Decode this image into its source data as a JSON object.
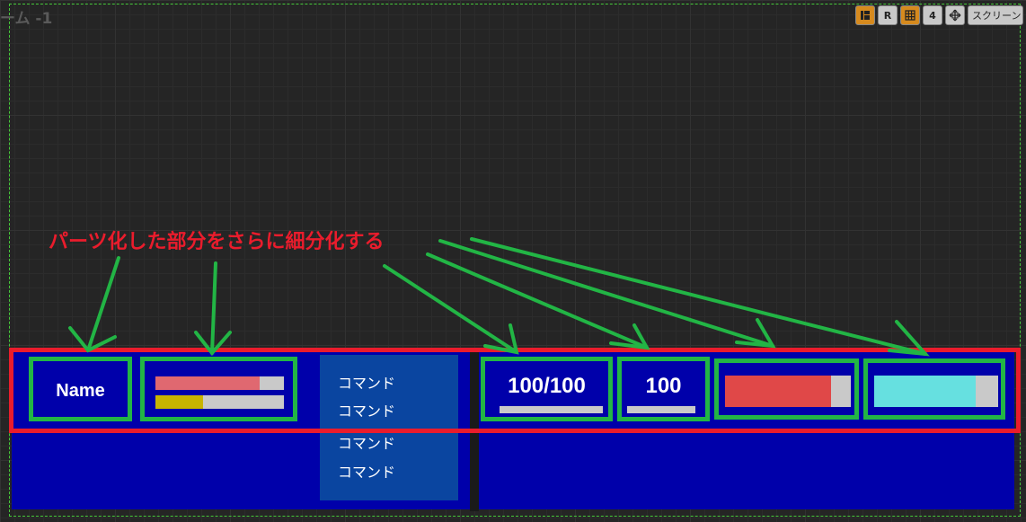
{
  "viewport": {
    "title": "ーム -1"
  },
  "toolbar": {
    "items": [
      {
        "icon": "layout-icon",
        "label": ""
      },
      {
        "icon": "",
        "label": "R"
      },
      {
        "icon": "grid-icon",
        "label": ""
      },
      {
        "icon": "",
        "label": "4"
      },
      {
        "icon": "move-icon",
        "label": ""
      },
      {
        "icon": "",
        "label": "スクリーン"
      }
    ]
  },
  "annotation": {
    "text": "パーツ化した部分をさらに細分化する",
    "color": "#ea1c2c"
  },
  "hud": {
    "name": "Name",
    "status_bars": {
      "hp_fraction": 0.81,
      "mp_fraction": 0.37
    },
    "commands": [
      "コマンド",
      "コマンド",
      "コマンド",
      "コマンド"
    ],
    "hp_text": "100/100",
    "mp_text": "100",
    "red_gauge_fraction": 0.84,
    "cyan_gauge_fraction": 0.82
  },
  "colors": {
    "panel": "#0000aa",
    "command_box": "#0a45a0",
    "highlight_green": "#22b545",
    "highlight_red": "#ea1c2c",
    "hp_fill": "#e06870",
    "mp_fill": "#c8b400",
    "red_gauge": "#e04848",
    "cyan_gauge": "#66e0e0"
  }
}
